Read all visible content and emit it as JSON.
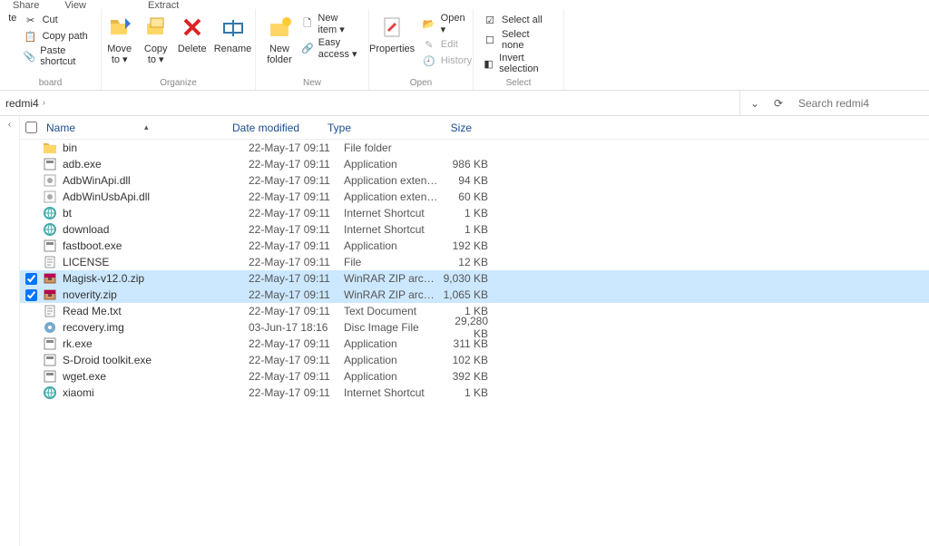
{
  "tabs": {
    "share": "Share",
    "view": "View",
    "extract": "Extract"
  },
  "ribbon": {
    "clipboard": {
      "label": "board",
      "cut": "Cut",
      "copy_path": "Copy path",
      "paste_shortcut": "Paste shortcut",
      "paste": "te"
    },
    "organize": {
      "label": "Organize",
      "move_to": "Move\nto ▾",
      "copy_to": "Copy\nto ▾",
      "delete": "Delete",
      "rename": "Rename"
    },
    "new": {
      "label": "New",
      "new_folder": "New\nfolder",
      "new_item": "New item ▾",
      "easy_access": "Easy access ▾"
    },
    "open": {
      "label": "Open",
      "properties": "Properties",
      "open_btn": "Open ▾",
      "edit": "Edit",
      "history": "History"
    },
    "select": {
      "label": "Select",
      "select_all": "Select all",
      "select_none": "Select none",
      "invert": "Invert selection"
    }
  },
  "breadcrumb": {
    "folder": "redmi4",
    "sep": "›"
  },
  "search": {
    "placeholder": "Search redmi4"
  },
  "columns": {
    "name": "Name",
    "date": "Date modified",
    "type": "Type",
    "size": "Size"
  },
  "files": [
    {
      "name": "bin",
      "date": "22-May-17 09:11",
      "type": "File folder",
      "size": "",
      "icon": "folder",
      "selected": false
    },
    {
      "name": "adb.exe",
      "date": "22-May-17 09:11",
      "type": "Application",
      "size": "986 KB",
      "icon": "exe",
      "selected": false
    },
    {
      "name": "AdbWinApi.dll",
      "date": "22-May-17 09:11",
      "type": "Application extens...",
      "size": "94 KB",
      "icon": "dll",
      "selected": false
    },
    {
      "name": "AdbWinUsbApi.dll",
      "date": "22-May-17 09:11",
      "type": "Application extens...",
      "size": "60 KB",
      "icon": "dll",
      "selected": false
    },
    {
      "name": "bt",
      "date": "22-May-17 09:11",
      "type": "Internet Shortcut",
      "size": "1 KB",
      "icon": "url",
      "selected": false
    },
    {
      "name": "download",
      "date": "22-May-17 09:11",
      "type": "Internet Shortcut",
      "size": "1 KB",
      "icon": "url",
      "selected": false
    },
    {
      "name": "fastboot.exe",
      "date": "22-May-17 09:11",
      "type": "Application",
      "size": "192 KB",
      "icon": "exe",
      "selected": false
    },
    {
      "name": "LICENSE",
      "date": "22-May-17 09:11",
      "type": "File",
      "size": "12 KB",
      "icon": "txt",
      "selected": false
    },
    {
      "name": "Magisk-v12.0.zip",
      "date": "22-May-17 09:11",
      "type": "WinRAR ZIP archive",
      "size": "9,030 KB",
      "icon": "zip",
      "selected": true
    },
    {
      "name": "noverity.zip",
      "date": "22-May-17 09:11",
      "type": "WinRAR ZIP archive",
      "size": "1,065 KB",
      "icon": "zip",
      "selected": true
    },
    {
      "name": "Read Me.txt",
      "date": "22-May-17 09:11",
      "type": "Text Document",
      "size": "1 KB",
      "icon": "txt",
      "selected": false
    },
    {
      "name": "recovery.img",
      "date": "03-Jun-17 18:16",
      "type": "Disc Image File",
      "size": "29,280 KB",
      "icon": "img",
      "selected": false
    },
    {
      "name": "rk.exe",
      "date": "22-May-17 09:11",
      "type": "Application",
      "size": "311 KB",
      "icon": "exe",
      "selected": false
    },
    {
      "name": "S-Droid toolkit.exe",
      "date": "22-May-17 09:11",
      "type": "Application",
      "size": "102 KB",
      "icon": "exe",
      "selected": false
    },
    {
      "name": "wget.exe",
      "date": "22-May-17 09:11",
      "type": "Application",
      "size": "392 KB",
      "icon": "exe",
      "selected": false
    },
    {
      "name": "xiaomi",
      "date": "22-May-17 09:11",
      "type": "Internet Shortcut",
      "size": "1 KB",
      "icon": "url",
      "selected": false
    }
  ]
}
